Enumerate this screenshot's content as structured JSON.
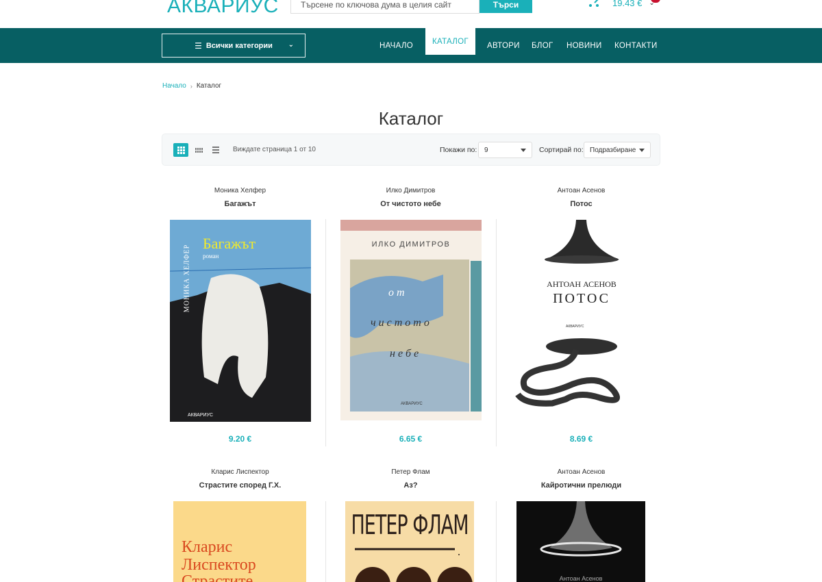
{
  "header": {
    "logo": "АКВАРИУС",
    "search_placeholder": "Търсене по ключова дума в целия сайт",
    "search_button": "Търси",
    "cart_total": "19.43 €"
  },
  "nav": {
    "categories_label": "Всички категории",
    "items": [
      {
        "label": "НАЧАЛО"
      },
      {
        "label": "КАТАЛОГ"
      },
      {
        "label": "АВТОРИ"
      },
      {
        "label": "БЛОГ"
      },
      {
        "label": "НОВИНИ"
      },
      {
        "label": "КОНТАКТИ"
      }
    ]
  },
  "breadcrumb": {
    "home": "Начало",
    "current": "Каталог"
  },
  "page_title": "Каталог",
  "toolbar": {
    "page_info": "Виждате страница 1 от 10",
    "show_label": "Покажи по:",
    "show_value": "9",
    "sort_label": "Сортирай по:",
    "sort_value": "Подразбиране"
  },
  "products": [
    {
      "author": "Моника Хелфер",
      "title": "Багажът",
      "price": "9.20 €",
      "cover": {
        "author_text": "МОНИКА ХЕЛФЕР",
        "title_text": "Багажът",
        "subtitle_text": "роман",
        "publisher": "АКВАРИУС"
      }
    },
    {
      "author": "Илко Димитров",
      "title": "От чистото небе",
      "price": "6.65 €",
      "cover": {
        "author_text": "ИЛКО ДИМИТРОВ",
        "line1": "о т",
        "line2": "ч и с т о т о",
        "line3": "н е б е",
        "publisher": "АКВАРИУС"
      }
    },
    {
      "author": "Антоан Асенов",
      "title": "Потос",
      "price": "8.69 €",
      "cover": {
        "author_text": "АНТОАН АСЕНОВ",
        "title_text": "ПОТОС",
        "publisher": "АКВАРИУС"
      }
    },
    {
      "author": "Кларис Лиспектор",
      "title": "Страстите според Г.Х.",
      "price": "",
      "cover": {
        "line1": "Кларис",
        "line2": "Лиспектор",
        "line3": "Страстите"
      }
    },
    {
      "author": "Петер Флам",
      "title": "Аз?",
      "price": "",
      "cover": {
        "author_text": "ПЕТЕР ФЛАМ"
      }
    },
    {
      "author": "Антоан Асенов",
      "title": "Кайротични прелюди",
      "price": "",
      "cover": {
        "author_text": "Антоан Асенов"
      }
    }
  ]
}
